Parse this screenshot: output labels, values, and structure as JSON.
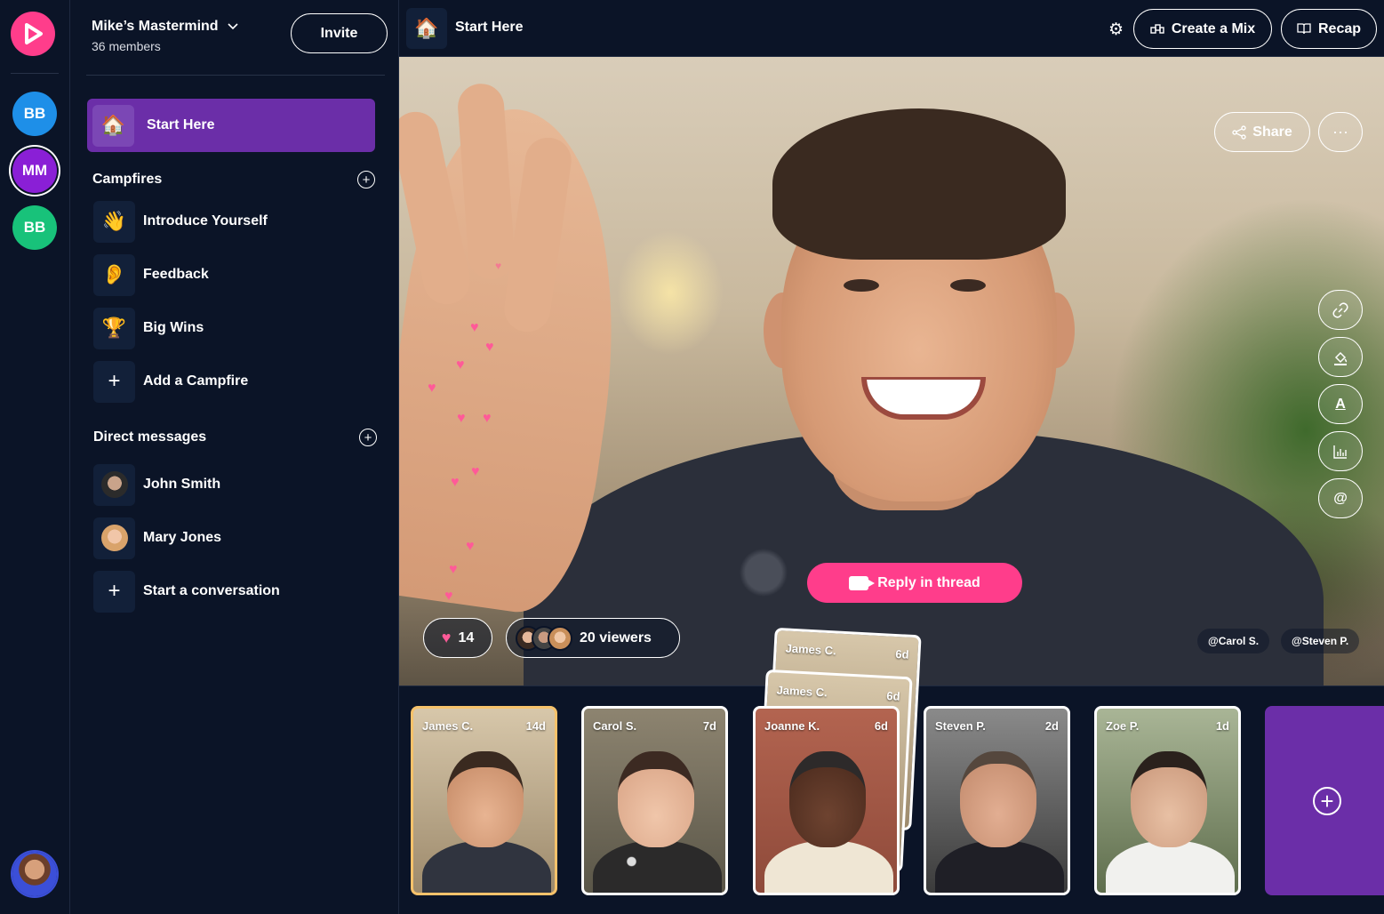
{
  "workspaces": [
    {
      "initials": "BB",
      "color": "#1e8fe8"
    },
    {
      "initials": "MM",
      "color": "#8a1fd6",
      "selected": true
    },
    {
      "initials": "BB",
      "color": "#18c27a"
    }
  ],
  "group": {
    "name": "Mike’s Mastermind",
    "members": "36 members",
    "invite_label": "Invite"
  },
  "sidebar": {
    "start_here": {
      "emoji": "🏠",
      "label": "Start Here"
    },
    "campfires_title": "Campfires",
    "campfires": [
      {
        "emoji": "👋",
        "label": "Introduce Yourself"
      },
      {
        "emoji": "👂",
        "label": "Feedback"
      },
      {
        "emoji": "🏆",
        "label": "Big Wins"
      },
      {
        "emoji": "+",
        "label": "Add a Campfire"
      }
    ],
    "dm_title": "Direct messages",
    "dms": [
      {
        "label": "John Smith"
      },
      {
        "label": "Mary Jones"
      },
      {
        "label": "Start a conversation"
      }
    ]
  },
  "topbar": {
    "emoji": "🏠",
    "title": "Start Here",
    "create_mix_label": "Create a Mix",
    "recap_label": "Recap"
  },
  "stage": {
    "share_label": "Share",
    "more_label": "···",
    "reply_label": "Reply in thread",
    "likes_count": "14",
    "viewers_label": "20 viewers",
    "tags": [
      "@Carol S.",
      "@Steven P."
    ],
    "tools": [
      "link-icon",
      "fill-icon",
      "text-icon",
      "chart-icon",
      "mention-icon"
    ],
    "mention_glyph": "@",
    "text_glyph": "A"
  },
  "thumbnails": [
    {
      "name": "James C.",
      "age": "14d"
    },
    {
      "name": "Carol S.",
      "age": "7d"
    },
    {
      "name": "Joanne K.",
      "age": "6d"
    },
    {
      "name": "Steven P.",
      "age": "2d"
    },
    {
      "name": "Zoe P.",
      "age": "1d"
    }
  ],
  "stack_cards": [
    {
      "name": "James C.",
      "age": "6d"
    },
    {
      "name": "James C.",
      "age": "6d"
    }
  ],
  "colors": {
    "accent_pink": "#ff3d8b",
    "accent_purple": "#6b2ea8",
    "background": "#0b1427",
    "active_thumb_border": "#f6c26b"
  }
}
